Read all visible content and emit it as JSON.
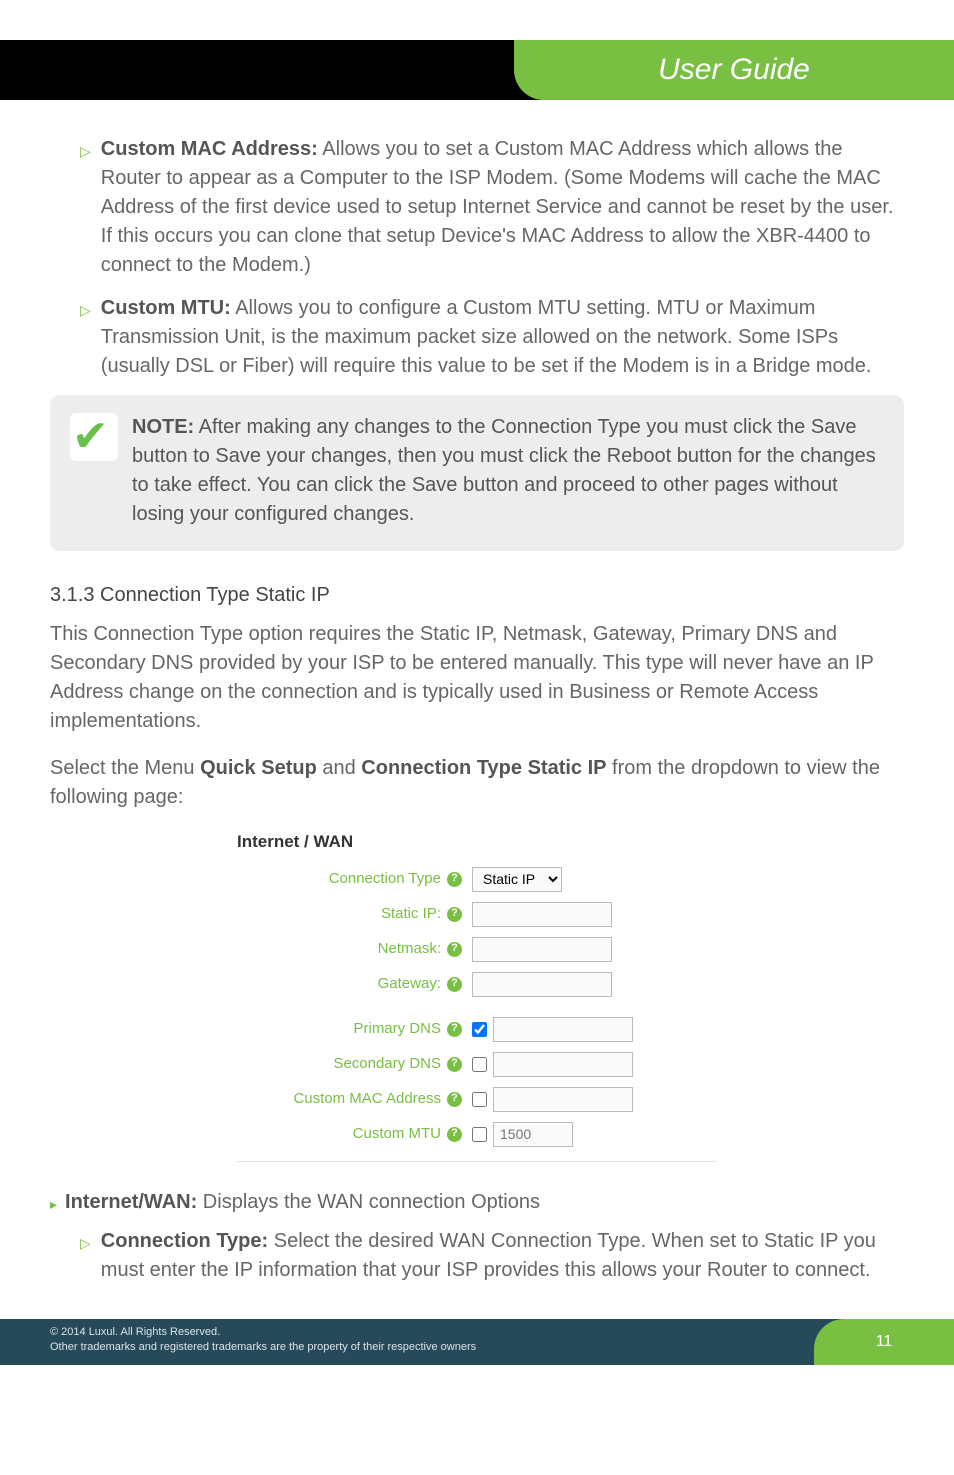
{
  "header": {
    "title": "User Guide"
  },
  "bullets": [
    {
      "label": "Custom MAC Address:",
      "text": " Allows you to set a Custom MAC Address which allows the Router to appear as a Computer to the ISP Modem. (Some Modems will cache the MAC Address of the first device used to setup Internet Service and cannot be reset by the user. If this occurs you can clone that setup Device's MAC Address to allow the XBR-4400 to connect to the Modem.)"
    },
    {
      "label": "Custom MTU:",
      "text": " Allows you to configure a Custom MTU setting. MTU or Maximum Transmission Unit, is the maximum packet size allowed on the network. Some ISPs (usually DSL or Fiber) will require this value to be set if the Modem is in a Bridge mode."
    }
  ],
  "note": {
    "label": "NOTE:",
    "text": " After making any changes to the Connection Type you must click the Save button to Save your changes, then you must click the Reboot button for the changes to take effect. You can click the Save button and proceed to other pages without losing your configured changes."
  },
  "section": {
    "heading": "3.1.3 Connection Type Static IP",
    "para1": "This Connection Type option requires the Static IP, Netmask, Gateway, Primary DNS and Secondary DNS provided by your ISP to be entered manually. This type will never have an IP Address change on the connection and is typically used in Business or Remote Access implementations.",
    "para2_pre": "Select the Menu ",
    "para2_b1": "Quick Setup",
    "para2_mid": " and ",
    "para2_b2": "Connection Type Static IP",
    "para2_post": " from the dropdown to view the following page:"
  },
  "form": {
    "title": "Internet / WAN",
    "conn_type_label": "Connection Type",
    "conn_type_value": "Static IP",
    "static_ip_label": "Static IP:",
    "netmask_label": "Netmask:",
    "gateway_label": "Gateway:",
    "primary_dns_label": "Primary DNS",
    "secondary_dns_label": "Secondary DNS",
    "custom_mac_label": "Custom MAC Address",
    "custom_mtu_label": "Custom MTU",
    "custom_mtu_placeholder": "1500"
  },
  "lower": {
    "main_label": "Internet/WAN:",
    "main_text": " Displays the WAN connection Options",
    "sub_label": "Connection Type:",
    "sub_text": " Select the desired WAN Connection Type. When set to Static IP you must enter the IP information that your ISP provides this allows your Router to connect."
  },
  "footer": {
    "line1": "© 2014  Luxul. All Rights Reserved.",
    "line2": "Other trademarks and registered trademarks are the property of their respective owners",
    "page": "11"
  }
}
